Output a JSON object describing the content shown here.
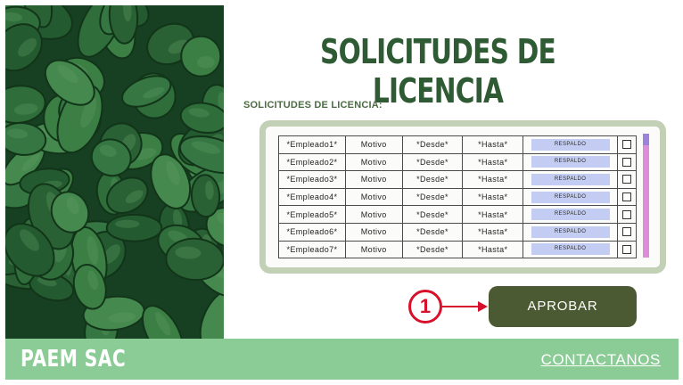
{
  "page": {
    "title": "SOLICITUDES DE LICENCIA",
    "subtitle": "SOLICITUDES DE LICENCIA:"
  },
  "table": {
    "rows": [
      {
        "empleado": "*Empleado1*",
        "motivo": "Motivo",
        "desde": "*Desde*",
        "hasta": "*Hasta*",
        "respaldo": "RESPALDO",
        "checked": false
      },
      {
        "empleado": "*Empleado2*",
        "motivo": "Motivo",
        "desde": "*Desde*",
        "hasta": "*Hasta*",
        "respaldo": "RESPALDO",
        "checked": false
      },
      {
        "empleado": "*Empleado3*",
        "motivo": "Motivo",
        "desde": "*Desde*",
        "hasta": "*Hasta*",
        "respaldo": "RESPALDO",
        "checked": false
      },
      {
        "empleado": "*Empleado4*",
        "motivo": "Motivo",
        "desde": "*Desde*",
        "hasta": "*Hasta*",
        "respaldo": "RESPALDO",
        "checked": false
      },
      {
        "empleado": "*Empleado5*",
        "motivo": "Motivo",
        "desde": "*Desde*",
        "hasta": "*Hasta*",
        "respaldo": "RESPALDO",
        "checked": false
      },
      {
        "empleado": "*Empleado6*",
        "motivo": "Motivo",
        "desde": "*Desde*",
        "hasta": "*Hasta*",
        "respaldo": "RESPALDO",
        "checked": false
      },
      {
        "empleado": "*Empleado7*",
        "motivo": "Motivo",
        "desde": "*Desde*",
        "hasta": "*Hasta*",
        "respaldo": "RESPALDO",
        "checked": false
      }
    ]
  },
  "annotation": {
    "step_number": "1"
  },
  "actions": {
    "approve_label": "APROBAR"
  },
  "footer": {
    "brand": "PAEM SAC",
    "contact_label": "CONTACTANOS"
  },
  "colors": {
    "title": "#2e5a34",
    "table_border": "#c2d1b6",
    "respaldo_button": "#c3cdf3",
    "scrollbar_track": "#dc8fd8",
    "scrollbar_thumb": "#9b83dc",
    "approve_button": "#4b5a32",
    "annotation_red": "#d7102b",
    "footer": "#8bcc96"
  },
  "icons": {
    "hero_image": "avocado-photo",
    "annotation_arrow": "arrow-right-icon"
  }
}
